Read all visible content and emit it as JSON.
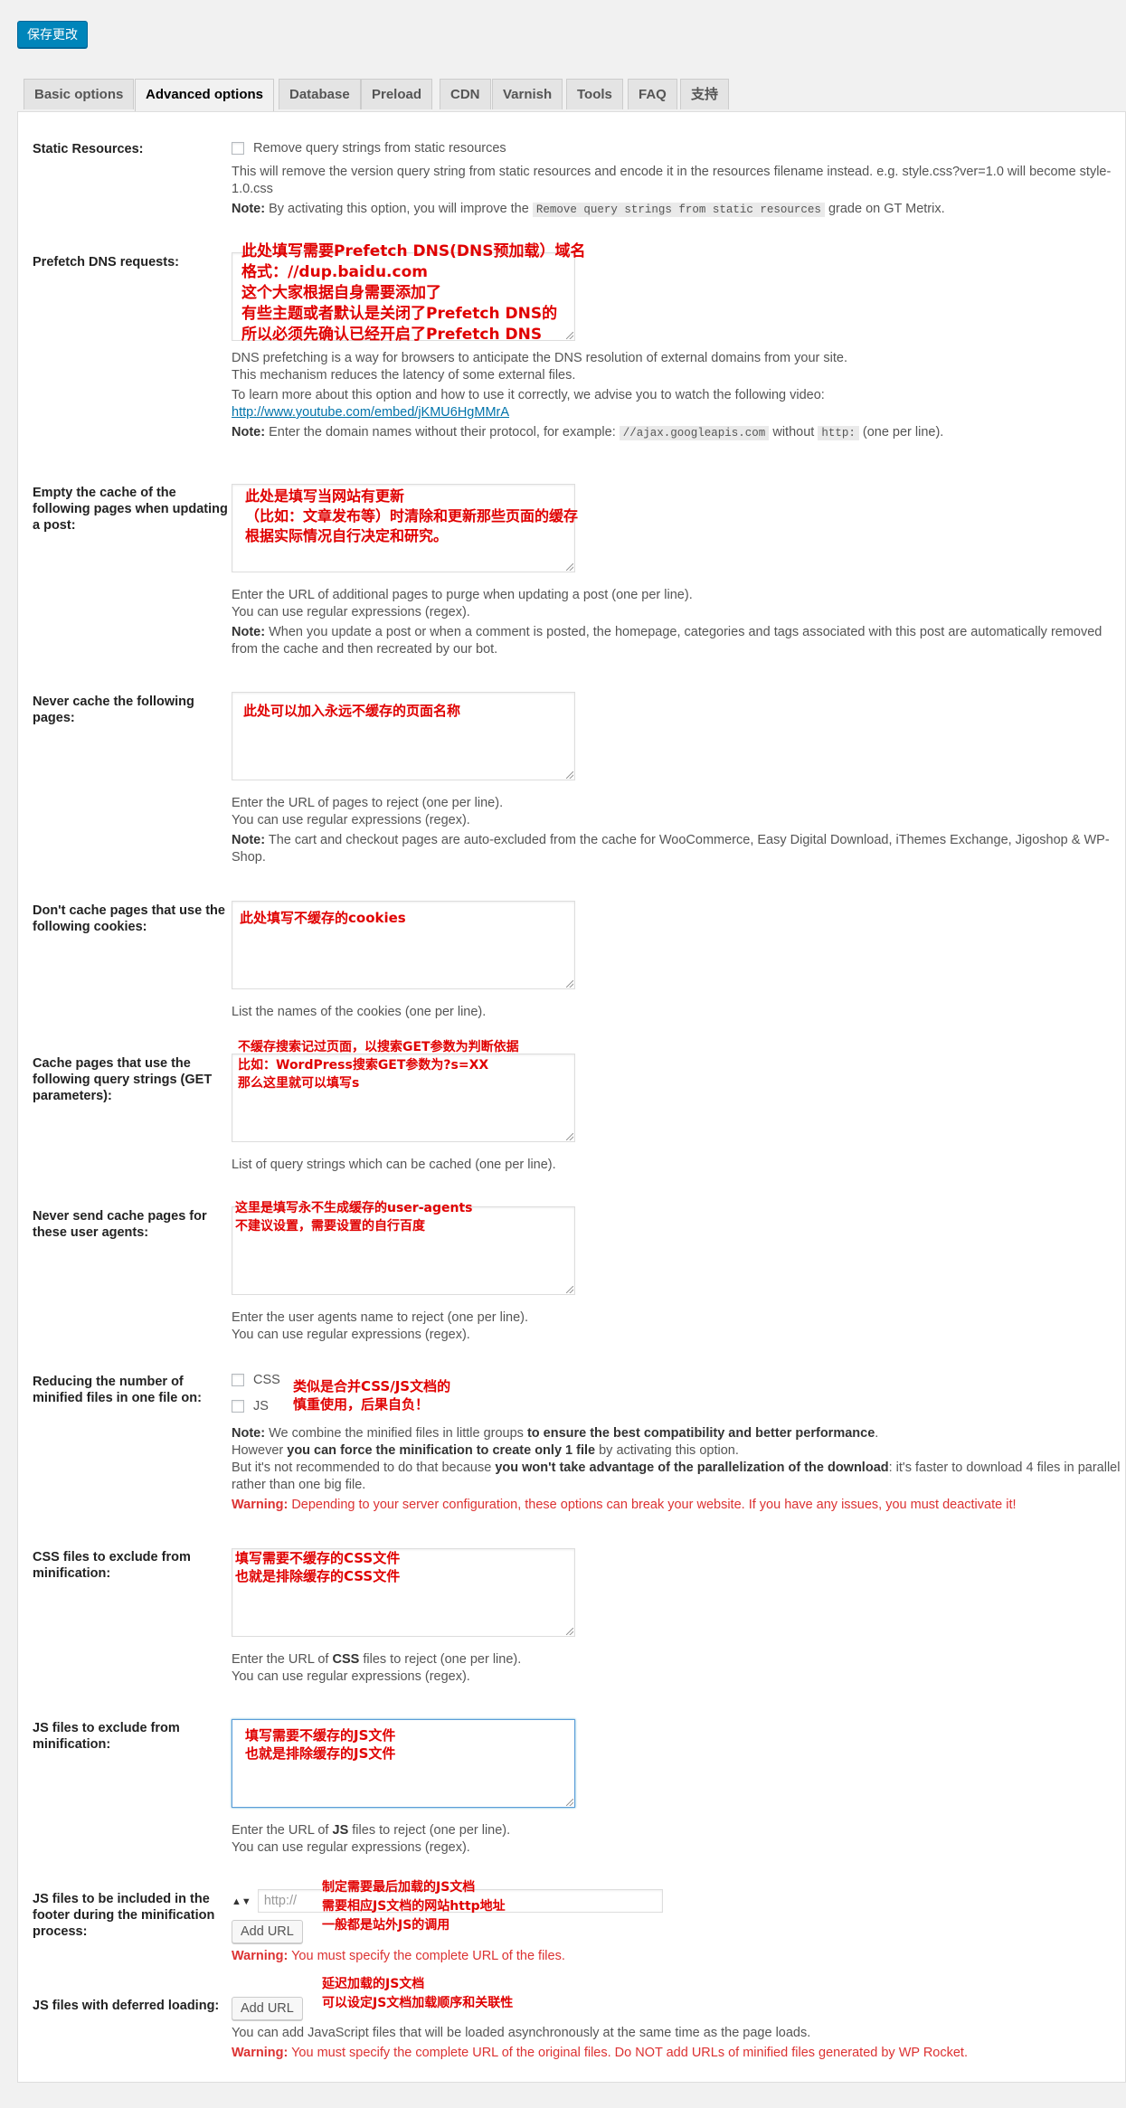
{
  "save_button": "保存更改",
  "tabs": [
    "Basic options",
    "Advanced options",
    "Database",
    "Preload",
    "CDN",
    "Varnish",
    "Tools",
    "FAQ",
    "支持"
  ],
  "static_resources": {
    "label": "Static Resources:",
    "checkbox_label": "Remove query strings from static resources",
    "desc1": "This will remove the version query string from static resources and encode it in the resources filename instead. e.g. style.css?ver=1.0 will become style-1.0.css",
    "note_label": "Note:",
    "note_pre": "By activating this option, you will improve the",
    "note_code": "Remove query strings from static resources",
    "note_post": "grade on GT Metrix."
  },
  "prefetch_dns": {
    "label": "Prefetch DNS requests:",
    "annotation": [
      "此处填写需要Prefetch DNS(DNS预加载）域名",
      "格式：//dup.baidu.com",
      "这个大家根据自身需要添加了",
      "有些主题或者默认是关闭了Prefetch DNS的",
      "所以必须先确认已经开启了Prefetch DNS"
    ],
    "desc1": "DNS prefetching is a way for browsers to anticipate the DNS resolution of external domains from your site.",
    "desc2": "This mechanism reduces the latency of some external files.",
    "desc3": "To learn more about this option and how to use it correctly, we advise you to watch the following video:",
    "link": "http://www.youtube.com/embed/jKMU6HgMMrA",
    "note_label": "Note:",
    "note_pre": "Enter the domain names without their protocol, for example:",
    "note_code1": "//ajax.googleapis.com",
    "note_mid": "without",
    "note_code2": "http:",
    "note_post": "(one per line)."
  },
  "empty_cache": {
    "label": "Empty the cache of the following pages when updating a post:",
    "annotation": [
      "此处是填写当网站有更新",
      "（比如：文章发布等）时清除和更新那些页面的缓存",
      "根据实际情况自行决定和研究。"
    ],
    "desc1": "Enter the URL of additional pages to purge when updating a post (one per line).",
    "desc2": "You can use regular expressions (regex).",
    "note_label": "Note:",
    "note": "When you update a post or when a comment is posted, the homepage, categories and tags associated with this post are automatically removed from the cache and then recreated by our bot."
  },
  "never_cache": {
    "label": "Never cache the following pages:",
    "annotation": [
      "此处可以加入永远不缓存的页面名称"
    ],
    "desc1": "Enter the URL of pages to reject (one per line).",
    "desc2": "You can use regular expressions (regex).",
    "note_label": "Note:",
    "note": "The cart and checkout pages are auto-excluded from the cache for WooCommerce, Easy Digital Download, iThemes Exchange, Jigoshop & WP-Shop."
  },
  "cookies": {
    "label": "Don't cache pages that use the following cookies:",
    "annotation": [
      "此处填写不缓存的cookies"
    ],
    "desc1": "List the names of the cookies (one per line)."
  },
  "query_strings": {
    "label": "Cache pages that use the following query strings (GET parameters):",
    "annotation": [
      "不缓存搜索记过页面，以搜索GET参数为判断依据",
      "比如：WordPress搜索GET参数为?s=XX",
      "那么这里就可以填写s"
    ],
    "desc1": "List of query strings which can be cached (one per line)."
  },
  "user_agents": {
    "label": "Never send cache pages for these user agents:",
    "annotation": [
      "这里是填写永不生成缓存的user-agents",
      "不建议设置，需要设置的自行百度"
    ],
    "desc1": "Enter the user agents name to reject (one per line).",
    "desc2": "You can use regular expressions (regex)."
  },
  "minify_count": {
    "label": "Reducing the number of minified files in one file on:",
    "css": "CSS",
    "js": "JS",
    "annotation": [
      "类似是合并CSS/JS文档的",
      "慎重使用，后果自负！"
    ],
    "note_label": "Note:",
    "note_pre": "We combine the minified files in little groups",
    "note_bold": "to ensure the best compatibility and better performance",
    "line2_pre": "However",
    "line2_bold": "you can force the minification to create only 1 file",
    "line2_post": "by activating this option.",
    "line3_pre": "But it's not recommended to do that because",
    "line3_bold": "you won't take advantage of the parallelization of the download",
    "line3_post": ": it's faster to download 4 files in parallel rather than one big file.",
    "warning_label": "Warning:",
    "warning": "Depending to your server configuration, these options can break your website. If you have any issues, you must deactivate it!"
  },
  "css_exclude": {
    "label": "CSS files to exclude from minification:",
    "annotation": [
      "填写需要不缓存的CSS文件",
      "也就是排除缓存的CSS文件"
    ],
    "desc1_pre": "Enter the URL of",
    "desc1_bold": "CSS",
    "desc1_post": "files to reject (one per line).",
    "desc2": "You can use regular expressions (regex)."
  },
  "js_exclude": {
    "label": "JS files to exclude from minification:",
    "annotation": [
      "填写需要不缓存的JS文件",
      "也就是排除缓存的JS文件"
    ],
    "desc1_pre": "Enter the URL of",
    "desc1_bold": "JS",
    "desc1_post": "files to reject (one per line).",
    "desc2": "You can use regular expressions (regex)."
  },
  "js_footer": {
    "label": "JS files to be included in the footer during the minification process:",
    "placeholder": "http://",
    "add_url": "Add URL",
    "annotation": [
      "制定需要最后加载的JS文档",
      "需要相应JS文档的网站http地址",
      "一般都是站外JS的调用"
    ],
    "warning_label": "Warning:",
    "warning": "You must specify the complete URL of the files."
  },
  "js_deferred": {
    "label": "JS files with deferred loading:",
    "add_url": "Add URL",
    "annotation": [
      "延迟加载的JS文档",
      "可以设定JS文档加载顺序和关联性"
    ],
    "desc1": "You can add JavaScript files that will be loaded asynchronously at the same time as the page loads.",
    "warning_label": "Warning:",
    "warning": "You must specify the complete URL of the original files. Do NOT add URLs of minified files generated by WP Rocket."
  },
  "colors": {
    "primary": "#0085ba",
    "annotation": "#e00000",
    "warning": "#dc3232",
    "link": "#0073aa"
  },
  "icons": {
    "sort": "up-down-arrows-icon",
    "resize": "resize-grip-icon"
  }
}
